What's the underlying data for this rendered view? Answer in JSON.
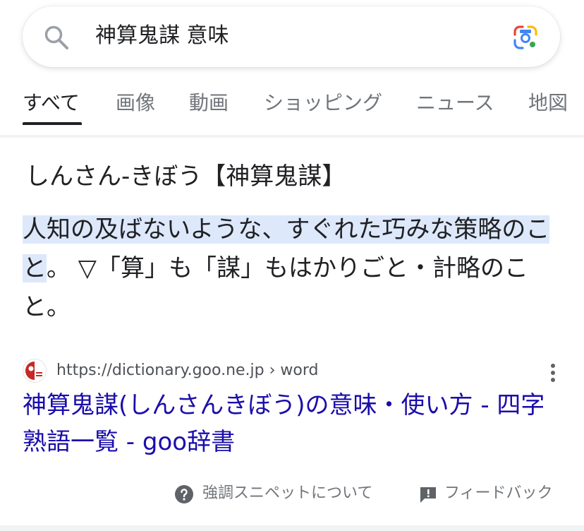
{
  "search": {
    "query": "神算鬼謀 意味"
  },
  "icons": {
    "search": "search-icon",
    "lens": "google-lens-icon",
    "favicon": "goo-dictionary-favicon",
    "more": "more-vert-icon",
    "about": "help-circle-icon",
    "feedback": "feedback-icon"
  },
  "tabs": [
    {
      "label": "すべて",
      "active": true
    },
    {
      "label": "画像",
      "active": false
    },
    {
      "label": "動画",
      "active": false
    },
    {
      "label": "ショッピング",
      "active": false
    },
    {
      "label": "ニュース",
      "active": false
    },
    {
      "label": "地図",
      "active": false
    }
  ],
  "snippet": {
    "heading": "しんさん-きぼう【神算鬼謀】",
    "highlighted": "人知の及ばないような、すぐれた巧みな策略のこと",
    "rest": "。 ▽「算」も「謀」もはかりごと・計略のこと。"
  },
  "result": {
    "url": "https://dictionary.goo.ne.jp › word",
    "title": "神算鬼謀(しんさんきぼう)の意味・使い方 - 四字熟語一覧 - goo辞書"
  },
  "footer": {
    "about_label": "強調スニペットについて",
    "feedback_label": "フィードバック"
  },
  "colors": {
    "link": "#1a0dab",
    "highlight": "#dde8fb",
    "secondary_text": "#70757a"
  }
}
